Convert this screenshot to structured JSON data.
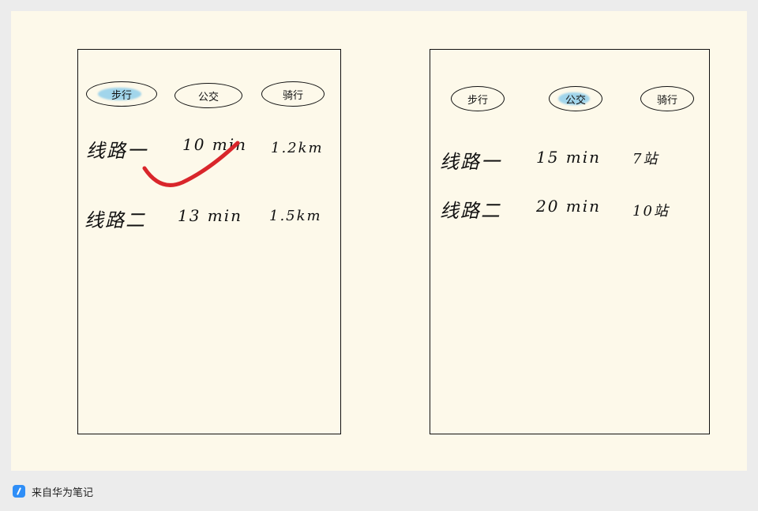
{
  "footer": {
    "source_text": "来自华为笔记",
    "icon": "huawei-notes-icon"
  },
  "left_panel": {
    "tabs": [
      {
        "label": "步行",
        "selected": true
      },
      {
        "label": "公交",
        "selected": false
      },
      {
        "label": "骑行",
        "selected": false
      }
    ],
    "rows": [
      {
        "route": "线路一",
        "time": "10 min",
        "distance": "1.2km",
        "checked": true
      },
      {
        "route": "线路二",
        "time": "13 min",
        "distance": "1.5km",
        "checked": false
      }
    ],
    "check_color": "#d9262b"
  },
  "right_panel": {
    "tabs": [
      {
        "label": "步行",
        "selected": false
      },
      {
        "label": "公交",
        "selected": true
      },
      {
        "label": "骑行",
        "selected": false
      }
    ],
    "rows": [
      {
        "route": "线路一",
        "time": "15 min",
        "stops": "7站"
      },
      {
        "route": "线路二",
        "time": "20 min",
        "stops": "10站"
      }
    ]
  },
  "colors": {
    "paper": "#fdf9ea",
    "highlight": "#82c8eb",
    "ink": "#111111"
  }
}
